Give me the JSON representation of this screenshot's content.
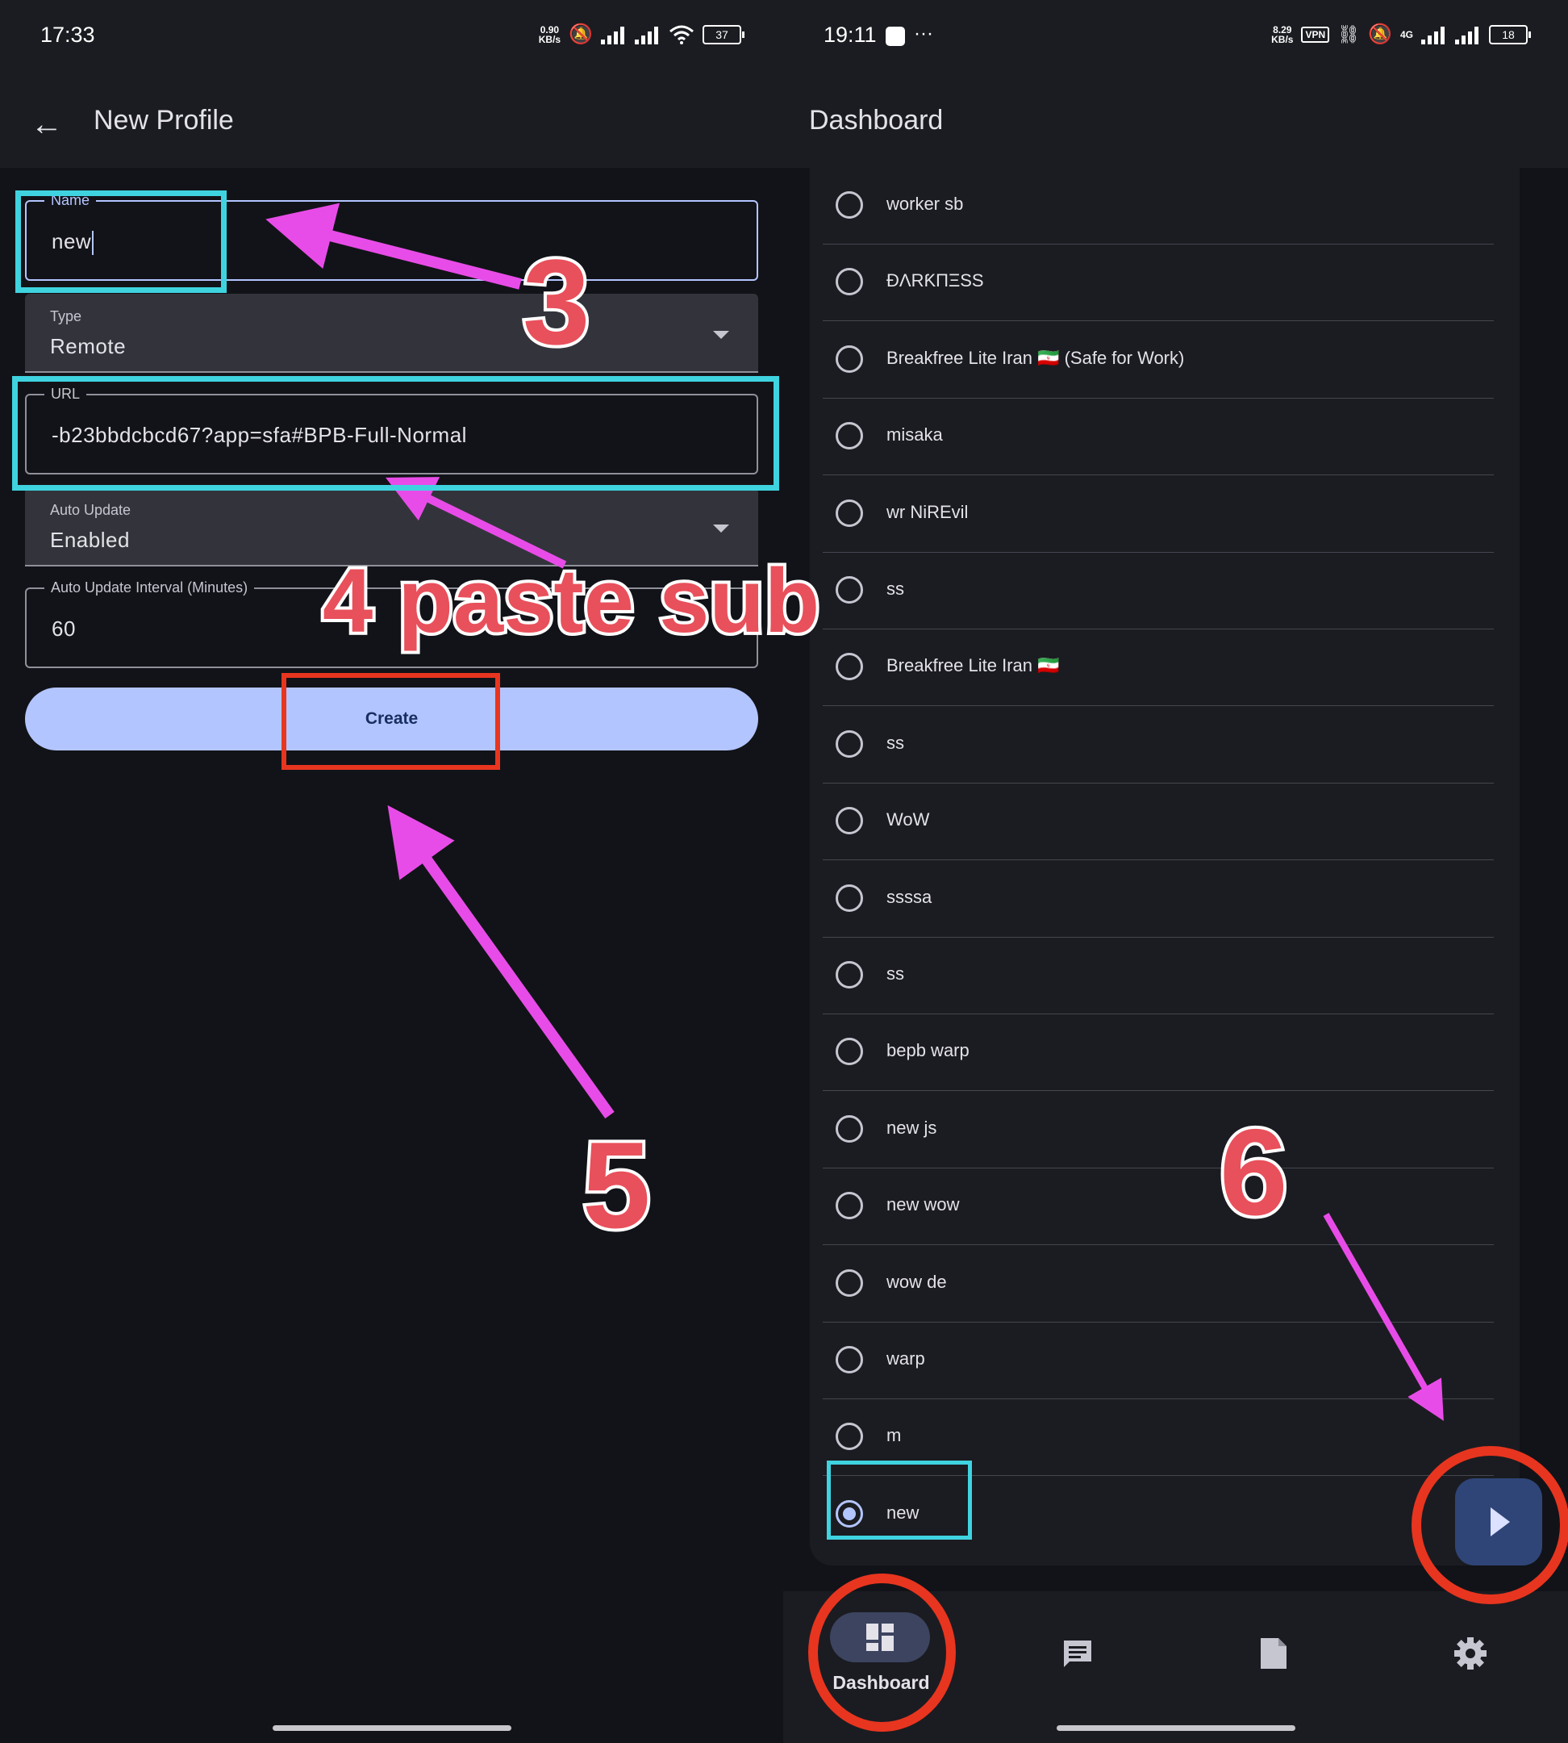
{
  "left": {
    "status": {
      "time": "17:33",
      "speed_top": "0.90",
      "speed_unit": "KB/s",
      "battery": "37"
    },
    "appbar": {
      "title": "New Profile",
      "back_icon": "arrow-left-icon"
    },
    "form": {
      "name_label": "Name",
      "name_value": "new",
      "type_label": "Type",
      "type_value": "Remote",
      "url_label": "URL",
      "url_value": "-b23bbdcbcd67?app=sfa#BPB-Full-Normal",
      "auto_update_label": "Auto Update",
      "auto_update_value": "Enabled",
      "interval_label": "Auto Update Interval (Minutes)",
      "interval_value": "60",
      "create_label": "Create"
    }
  },
  "right": {
    "status": {
      "time": "19:11",
      "more": "···",
      "speed_top": "8.29",
      "speed_unit": "KB/s",
      "vpn": "VPN",
      "net": "4G",
      "battery": "18"
    },
    "appbar": {
      "title": "Dashboard"
    },
    "profiles": [
      {
        "label": "worker sb",
        "selected": false
      },
      {
        "label": "ÐΛRƘПΞSS",
        "selected": false
      },
      {
        "label": "Breakfree Lite Iran 🇮🇷 (Safe for Work)",
        "selected": false
      },
      {
        "label": "misaka",
        "selected": false
      },
      {
        "label": "wr NiREvil",
        "selected": false
      },
      {
        "label": "ss",
        "selected": false
      },
      {
        "label": "Breakfree Lite Iran 🇮🇷",
        "selected": false
      },
      {
        "label": "ss",
        "selected": false
      },
      {
        "label": "WoW",
        "selected": false
      },
      {
        "label": "ssssa",
        "selected": false
      },
      {
        "label": "ss",
        "selected": false
      },
      {
        "label": "bepb warp",
        "selected": false
      },
      {
        "label": "new js",
        "selected": false
      },
      {
        "label": "new wow",
        "selected": false
      },
      {
        "label": "wow de",
        "selected": false
      },
      {
        "label": "warp",
        "selected": false
      },
      {
        "label": "m",
        "selected": false
      },
      {
        "label": "new",
        "selected": true
      }
    ],
    "fab_icon": "play-icon",
    "nav": {
      "dashboard_label": "Dashboard",
      "items": [
        "dashboard-icon",
        "chat-icon",
        "document-icon",
        "gear-icon"
      ]
    }
  },
  "annotations": {
    "step3": "3",
    "step4": "4 paste sub",
    "step5": "5",
    "step6": "6",
    "arrow_color": "#e84ce8",
    "cyan_box_color": "#3fd3e0",
    "red_box_color": "#e8351f"
  }
}
